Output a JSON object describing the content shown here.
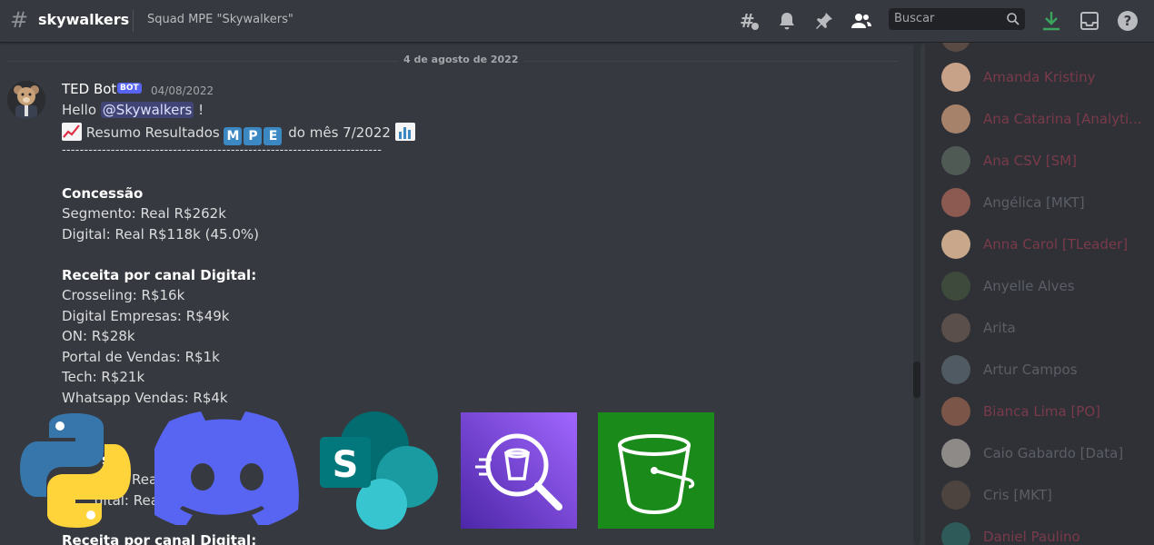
{
  "header": {
    "channel_name": "skywalkers",
    "topic": "Squad MPE \"Skywalkers\"",
    "search_placeholder": "Buscar"
  },
  "chat": {
    "date_separator": "4 de agosto de 2022",
    "message": {
      "author": "TED Bot",
      "bot_tag": "BOT",
      "timestamp": "04/08/2022",
      "greeting_prefix": "Hello ",
      "mention": "@Skywalkers",
      "greeting_suffix": " !",
      "summary_prefix": "Resumo Resultados",
      "summary_letters": [
        "M",
        "P",
        "E"
      ],
      "summary_suffix": "do mês 7/2022",
      "separator": "------------------------------------------------------------------------",
      "section1_title": "Concessão",
      "section1_lines": [
        "Segmento: Real R$262k",
        "Digital: Real R$118k (45.0%)"
      ],
      "section2_title": "Receita por canal Digital:",
      "section2_lines": [
        "Crosseling: R$16k",
        "Digital Empresas: R$49k",
        "ON: R$28k",
        "Portal de Vendas: R$1k",
        "Tech: R$21k",
        "Whatsapp Vendas: R$4k"
      ],
      "section3_title_fragment": "s",
      "section3_line1_fragment": "Real R$124k",
      "section3_line2_fragment": "gital: Real R$",
      "section4_title": "Receita por canal Digital:"
    }
  },
  "members": [
    {
      "name": "Amanda Kristiny",
      "color": "#7a3a4a"
    },
    {
      "name": "Ana Catarina [Analyti...",
      "color": "#7a3a4a"
    },
    {
      "name": "Ana CSV [SM]",
      "color": "#7a3a4a"
    },
    {
      "name": "Angélica [MKT]",
      "color": "#5b5e66"
    },
    {
      "name": "Anna Carol [TLeader]",
      "color": "#7a3a4a"
    },
    {
      "name": "Anyelle Alves",
      "color": "#5b5e66"
    },
    {
      "name": "Arita",
      "color": "#5b5e66"
    },
    {
      "name": "Artur Campos",
      "color": "#5b5e66"
    },
    {
      "name": "Bianca Lima [PO]",
      "color": "#7a3a4a"
    },
    {
      "name": "Caio Gabardo [Data]",
      "color": "#5b5e66"
    },
    {
      "name": "Cris [MKT]",
      "color": "#5b5e66"
    },
    {
      "name": "Daniel Paulino",
      "color": "#7a3a4a"
    }
  ],
  "icons": [
    "hashtag-icon",
    "threads-icon",
    "bell-icon",
    "pin-icon",
    "members-icon",
    "search-icon",
    "download-icon",
    "inbox-icon",
    "help-icon"
  ],
  "logos": [
    "python-logo",
    "discord-logo",
    "sharepoint-logo",
    "aws-s3-inspector-logo",
    "aws-s3-bucket-logo"
  ]
}
